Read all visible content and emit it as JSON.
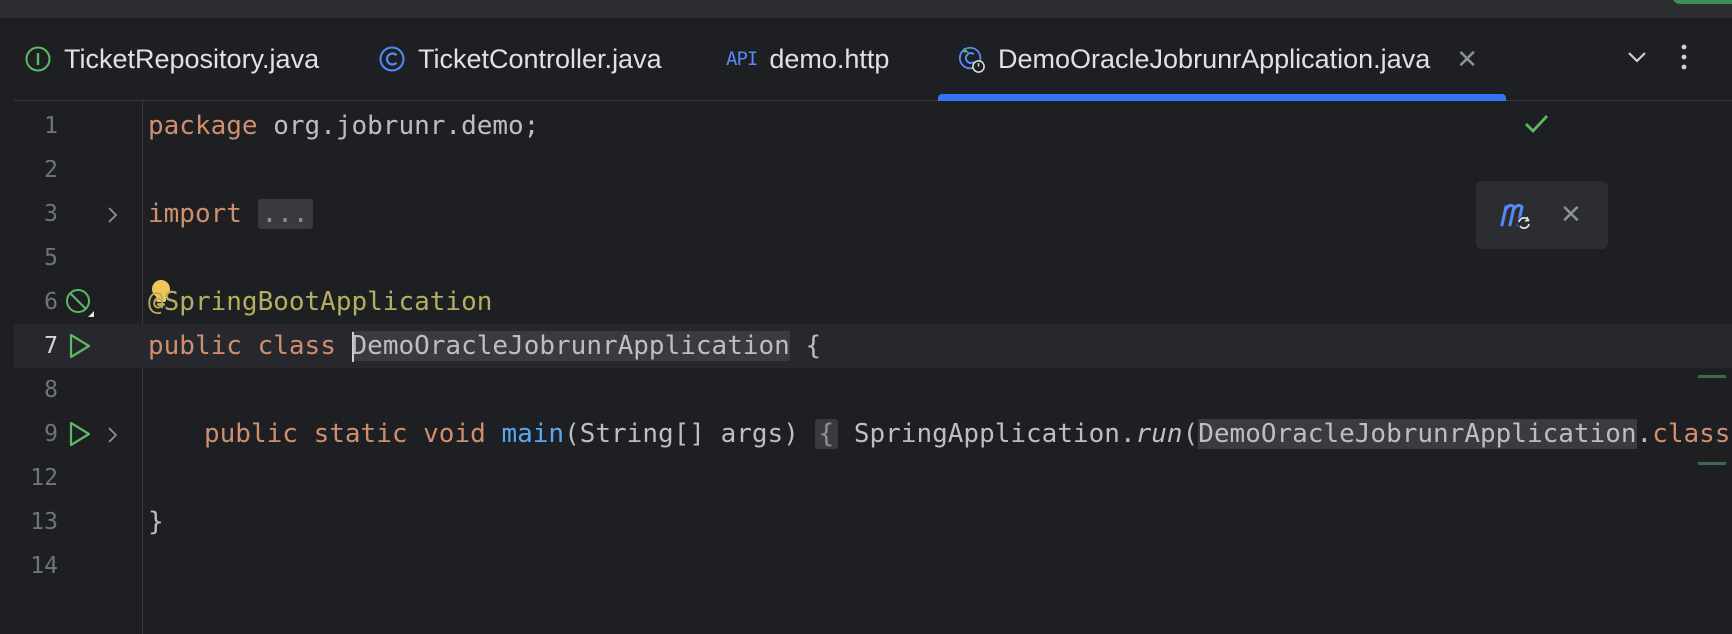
{
  "tabs": [
    {
      "label": "TicketRepository.java",
      "icon": "interface-icon"
    },
    {
      "label": "TicketController.java",
      "icon": "class-icon"
    },
    {
      "label": "demo.http",
      "icon": "api-icon",
      "icon_text": "API"
    },
    {
      "label": "DemoOracleJobrunrApplication.java",
      "icon": "spring-boot-class-icon",
      "active": true
    }
  ],
  "lines": {
    "l1": {
      "num": "1",
      "kw": "package",
      "rest": " org.jobrunr.demo;"
    },
    "l2": {
      "num": "2"
    },
    "l3": {
      "num": "3",
      "kw": "import",
      "fold": "..."
    },
    "l5": {
      "num": "5"
    },
    "l6": {
      "num": "6",
      "ann": "@SpringBootApplication"
    },
    "l7": {
      "num": "7",
      "kw1": "public",
      "kw2": "class",
      "name": "DemoOracleJobrunrApplication",
      "brace": " {"
    },
    "l8": {
      "num": "8"
    },
    "l9": {
      "num": "9",
      "kw1": "public",
      "kw2": "static",
      "kw3": "void",
      "fn": "main",
      "params": "(String[] args)",
      "fold": "{",
      "cls": "SpringApplication.",
      "run": "run",
      "paren": "(",
      "arg": "DemoOracleJobrunrApplication",
      "dot": ".",
      "kwc": "class"
    },
    "l12": {
      "num": "12"
    },
    "l13": {
      "num": "13",
      "brace": "}"
    },
    "l14": {
      "num": "14"
    }
  },
  "colors": {
    "accent": "#3574f0",
    "keyword": "#cf8e6d",
    "annotation": "#b3ae60",
    "function": "#56a8f5",
    "ok": "#5fb865"
  }
}
